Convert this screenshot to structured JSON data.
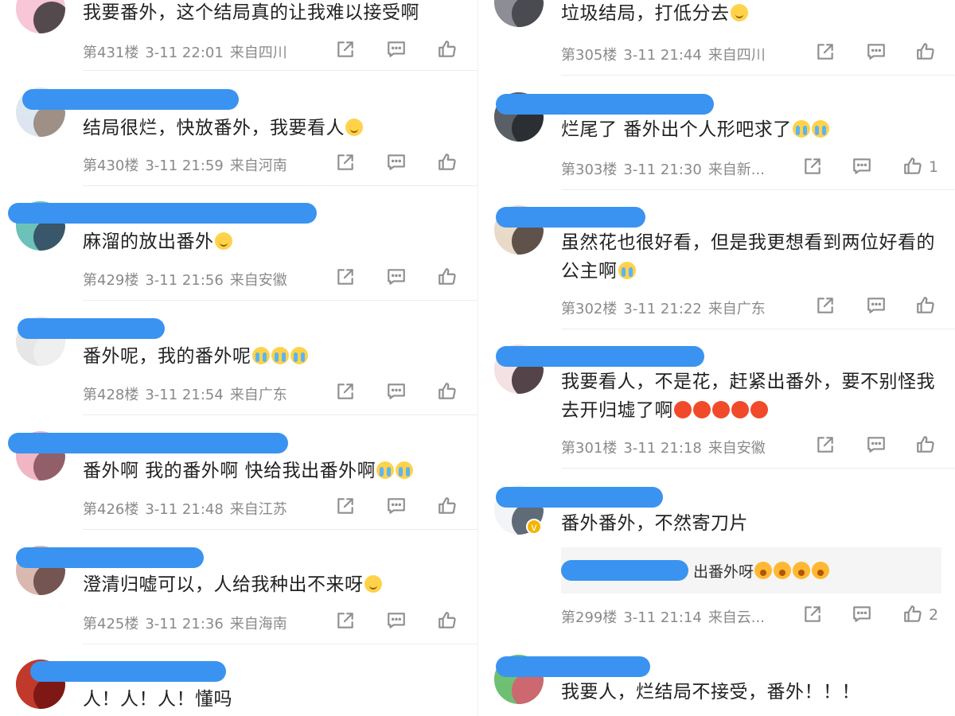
{
  "left": [
    {
      "text": "我要番外，这个结局真的让我难以接受啊",
      "emojis": [],
      "floor": "第431楼",
      "date": "3-11 22:01",
      "loc": "来自四川",
      "likes": "",
      "avatar": [
        "#f7c6d7",
        "#2b2b2b"
      ]
    },
    {
      "text": "结局很烂，快放番外，我要看人",
      "emojis": [
        "smile"
      ],
      "floor": "第430楼",
      "date": "3-11 21:59",
      "loc": "来自河南",
      "likes": "",
      "avatar": [
        "#dde6f0",
        "#8f7a6c"
      ]
    },
    {
      "text": "麻溜的放出番外",
      "emojis": [
        "smile"
      ],
      "floor": "第429楼",
      "date": "3-11 21:56",
      "loc": "来自安徽",
      "likes": "",
      "avatar": [
        "#6cc2b8",
        "#2d3b57"
      ]
    },
    {
      "text": "番外呢，我的番外呢",
      "emojis": [
        "cry",
        "cry",
        "cry"
      ],
      "floor": "第428楼",
      "date": "3-11 21:54",
      "loc": "来自广东",
      "likes": "",
      "avatar": [
        "#e6e6e6",
        "#f1f1f1"
      ]
    },
    {
      "text": "番外啊 我的番外啊 快给我出番外啊",
      "emojis": [
        "cry",
        "cry"
      ],
      "floor": "第426楼",
      "date": "3-11 21:48",
      "loc": "来自江苏",
      "likes": "",
      "avatar": [
        "#f1b6c4",
        "#7a4a52"
      ]
    },
    {
      "text": "澄清归嘘可以，人给我种出不来呀",
      "emojis": [
        "smile"
      ],
      "floor": "第425楼",
      "date": "3-11 21:36",
      "loc": "来自海南",
      "likes": "",
      "avatar": [
        "#d9b8b0",
        "#5a3c3a"
      ]
    },
    {
      "text": "人！人！人！懂吗",
      "emojis": [],
      "floor": "",
      "date": "",
      "loc": "",
      "likes": "",
      "avatar": [
        "#c0392b",
        "#6b1010"
      ]
    }
  ],
  "right": [
    {
      "text": "垃圾结局，打低分去",
      "emojis": [
        "smile"
      ],
      "floor": "第305楼",
      "date": "3-11 21:44",
      "loc": "来自四川",
      "likes": "",
      "avatar": [
        "#8d8d95",
        "#3a3a40"
      ]
    },
    {
      "text": "烂尾了 番外出个人形吧求了",
      "emojis": [
        "cry",
        "cry"
      ],
      "floor": "第303楼",
      "date": "3-11 21:30",
      "loc": "来自新...",
      "likes": "1",
      "avatar": [
        "#5a5f66",
        "#1f2328"
      ]
    },
    {
      "text": "虽然花也很好看，但是我更想看到两位好看的公主啊",
      "emojis": [
        "cry"
      ],
      "floor": "第302楼",
      "date": "3-11 21:22",
      "loc": "来自广东",
      "likes": "",
      "avatar": [
        "#e9d9c9",
        "#3b2f2a"
      ]
    },
    {
      "text": "我要看人，不是花，赶紧出番外，要不别怪我去开归墟了啊",
      "emojis": [
        "angry",
        "angry",
        "angry",
        "angry",
        "angry"
      ],
      "floor": "第301楼",
      "date": "3-11 21:18",
      "loc": "来自安徽",
      "likes": "",
      "avatar": [
        "#f3e1e4",
        "#2c1d22"
      ]
    },
    {
      "text": "番外番外，不然寄刀片",
      "emojis": [],
      "floor": "第299楼",
      "date": "3-11 21:14",
      "loc": "来自云...",
      "likes": "2",
      "avatar": [
        "#f2f4f7",
        "#3a4a57"
      ],
      "verified": "v",
      "reply": {
        "text": "出番外呀",
        "emojis": [
          "shock",
          "shock",
          "shock",
          "shock"
        ]
      }
    },
    {
      "text": "我要人，烂结局不接受，番外！！！",
      "emojis": [],
      "floor": "",
      "date": "",
      "loc": "",
      "likes": "",
      "avatar": [
        "#6fbf73",
        "#e5526f"
      ]
    }
  ],
  "colors": {
    "name_mask": "#3a93f0",
    "meta": "#8a8a8a",
    "icon": "#8f8f8f"
  }
}
